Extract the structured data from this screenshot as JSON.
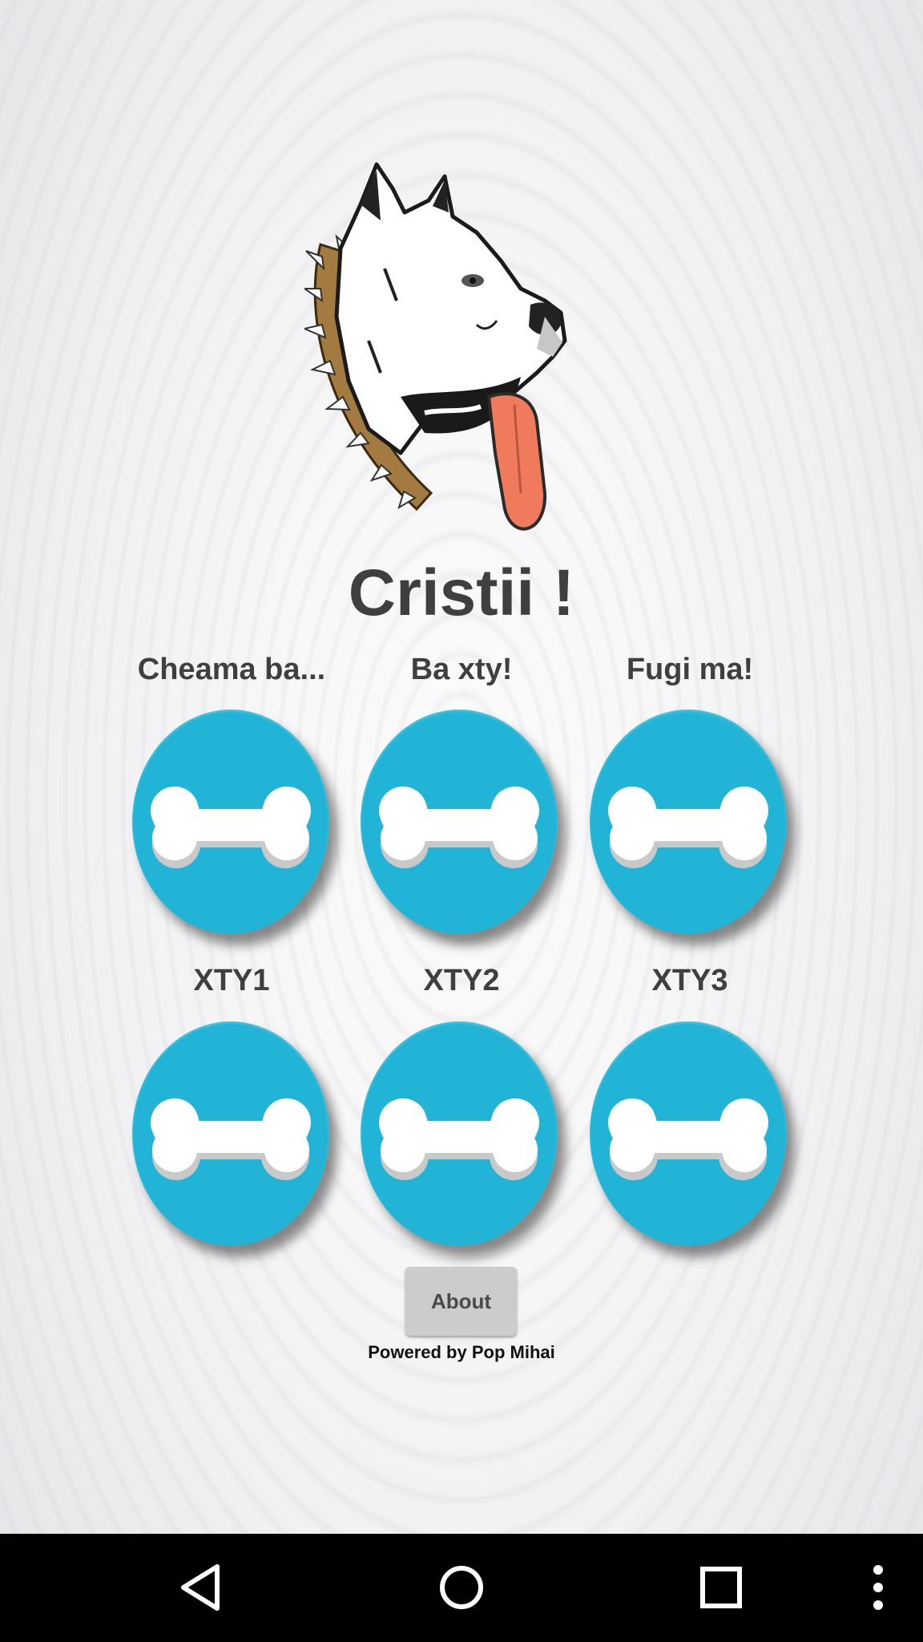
{
  "app": {
    "title": "Cristii !",
    "buttons_row1": [
      {
        "label": "Cheama ba...",
        "icon": "bone-icon"
      },
      {
        "label": "Ba xty!",
        "icon": "bone-icon"
      },
      {
        "label": "Fugi ma!",
        "icon": "bone-icon"
      }
    ],
    "buttons_row2": [
      {
        "label": "XTY1",
        "icon": "bone-icon"
      },
      {
        "label": "XTY2",
        "icon": "bone-icon"
      },
      {
        "label": "XTY3",
        "icon": "bone-icon"
      }
    ],
    "about_label": "About",
    "powered_by": "Powered by Pop Mihai",
    "colors": {
      "button_blue": "#21b4d6",
      "title_text": "#3f3f3f",
      "about_bg": "#cccccc",
      "navbar": "#000000"
    }
  },
  "navbar": {
    "icons": [
      "back-icon",
      "home-icon",
      "recents-icon",
      "more-icon"
    ]
  }
}
